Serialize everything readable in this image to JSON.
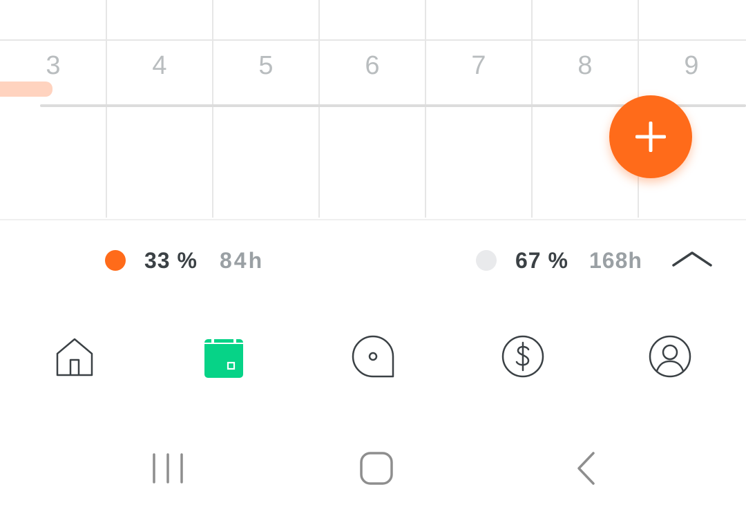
{
  "calendar": {
    "day_numbers": [
      "3",
      "4",
      "5",
      "6",
      "7",
      "8",
      "9"
    ]
  },
  "fab": {
    "icon": "plus-icon"
  },
  "summary": {
    "worked": {
      "color": "#ff6b1a",
      "percent": "33 %",
      "hours": "84h"
    },
    "remaining": {
      "color": "#e9eaec",
      "percent": "67 %",
      "hours": "168h"
    },
    "toggle_icon": "chevron-up-icon"
  },
  "bottom_nav": {
    "items": [
      {
        "icon": "home-icon",
        "active": false
      },
      {
        "icon": "calendar-icon",
        "active": true
      },
      {
        "icon": "chat-bubble-icon",
        "active": false
      },
      {
        "icon": "dollar-icon",
        "active": false
      },
      {
        "icon": "profile-icon",
        "active": false
      }
    ]
  },
  "system_nav": {
    "items": [
      "recent-apps-icon",
      "home-button-icon",
      "back-icon"
    ]
  },
  "colors": {
    "accent": "#ff6b1a",
    "active_nav": "#06d387",
    "icon_dark": "#3b4145",
    "grid_line": "#e6e6e6"
  }
}
